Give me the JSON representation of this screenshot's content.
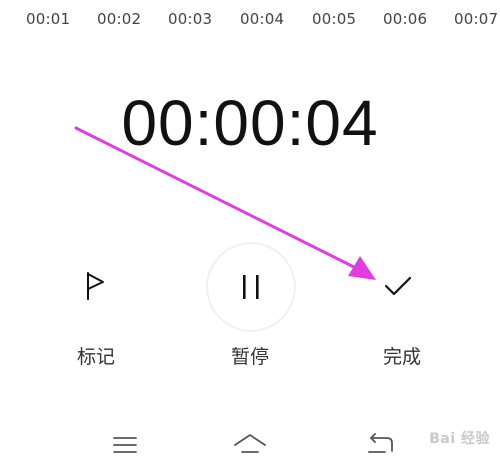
{
  "timeline": {
    "ticks": [
      "00:01",
      "00:02",
      "00:03",
      "00:04",
      "00:05",
      "00:06",
      "00:07"
    ]
  },
  "timer": {
    "elapsed": "00:00:04"
  },
  "controls": {
    "mark_label": "标记",
    "pause_label": "暂停",
    "done_label": "完成",
    "mark_icon": "flag-icon",
    "pause_icon": "pause-icon",
    "done_icon": "checkmark-icon"
  },
  "navbar": {
    "menu_icon": "menu-icon",
    "home_icon": "home-icon",
    "back_icon": "back-icon"
  },
  "annotation": {
    "arrow_color": "#e03ce0"
  },
  "watermark": {
    "text": "Bai 经验"
  }
}
